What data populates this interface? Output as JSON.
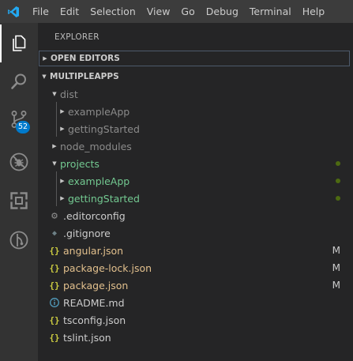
{
  "menubar": {
    "logo_icon": "vscode-logo-icon",
    "items": [
      "File",
      "Edit",
      "Selection",
      "View",
      "Go",
      "Debug",
      "Terminal",
      "Help"
    ]
  },
  "activitybar": {
    "items": [
      {
        "icon": "explorer-icon",
        "active": true
      },
      {
        "icon": "search-icon"
      },
      {
        "icon": "source-control-icon",
        "badge": "52"
      },
      {
        "icon": "debug-icon"
      },
      {
        "icon": "extensions-icon"
      },
      {
        "icon": "gitlens-icon"
      }
    ]
  },
  "sidebar": {
    "title": "EXPLORER",
    "sections": {
      "open_editors": "OPEN EDITORS",
      "project": "MULTIPLEAPPS"
    },
    "tree": [
      {
        "label": "dist",
        "color": "#8b8b8b"
      },
      {
        "label": "exampleApp",
        "color": "#8b8b8b"
      },
      {
        "label": "gettingStarted",
        "color": "#8b8b8b"
      },
      {
        "label": "node_modules",
        "color": "#8b8b8b"
      },
      {
        "label": "projects",
        "color": "#73c991"
      },
      {
        "label": "exampleApp",
        "color": "#73c991"
      },
      {
        "label": "gettingStarted",
        "color": "#73c991"
      },
      {
        "label": ".editorconfig",
        "icon": "gear-icon",
        "color": "#cccccc"
      },
      {
        "label": ".gitignore",
        "icon": "git-diamond-icon",
        "color": "#cccccc"
      },
      {
        "label": "angular.json",
        "icon": "json-braces-icon",
        "color": "#e2c08d",
        "status": "M"
      },
      {
        "label": "package-lock.json",
        "icon": "json-braces-icon",
        "color": "#e2c08d",
        "status": "M"
      },
      {
        "label": "package.json",
        "icon": "json-braces-icon",
        "color": "#e2c08d",
        "status": "M"
      },
      {
        "label": "README.md",
        "icon": "info-icon",
        "color": "#cccccc"
      },
      {
        "label": "tsconfig.json",
        "icon": "json-braces-icon",
        "color": "#cccccc"
      },
      {
        "label": "tslint.json",
        "icon": "json-braces-icon",
        "color": "#cccccc"
      }
    ]
  },
  "colors": {
    "accent": "#007acc",
    "modified": "#e2c08d",
    "untracked": "#73c991",
    "ignored": "#8b8b8b",
    "json_icon": "#cbcb41",
    "info_icon": "#519aba"
  }
}
